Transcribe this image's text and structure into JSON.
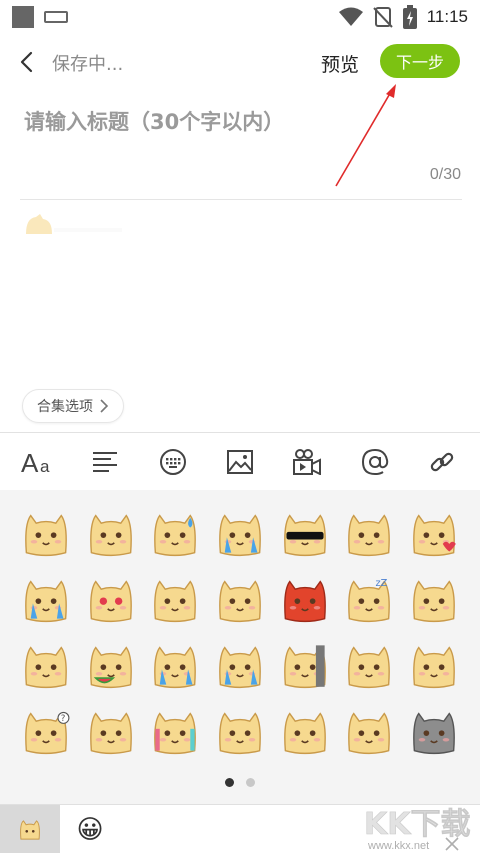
{
  "status_bar": {
    "time": "11:15"
  },
  "top_bar": {
    "saving_label": "保存中...",
    "preview_label": "预览",
    "next_label": "下一步"
  },
  "title_field": {
    "placeholder": "请输入标题（30个字以内）",
    "char_count": "0/30"
  },
  "body": {
    "collection_label": "合集选项"
  },
  "toolbar": {
    "items": [
      "font-icon",
      "align-icon",
      "keyboard-icon",
      "image-icon",
      "video-icon",
      "mention-icon",
      "link-icon"
    ],
    "font_label_big": "A",
    "font_label_small": "a"
  },
  "stickers": {
    "rows": 4,
    "columns": 7,
    "items": [
      "cat-blush",
      "cat-smile-cover",
      "cat-sweat",
      "cat-cry-blue",
      "cat-sunglasses",
      "cat-giggle",
      "cat-kiss-heart",
      "cat-cry-hands",
      "cat-heart-eyes",
      "cat-shy",
      "cat-think",
      "cat-angry-red",
      "cat-sleepy",
      "cat-sad",
      "cat-dizzy",
      "cat-watermelon",
      "cat-laugh-tears",
      "cat-sob",
      "cat-peek-wall",
      "cat-grin",
      "cat-shock",
      "cat-question",
      "cat-thumb",
      "cat-drink",
      "cat-tongue",
      "cat-neutral",
      "cat-laugh",
      "cat-grey-skull"
    ],
    "page_count": 2,
    "active_page": 1
  },
  "pack_bar": {
    "tabs": [
      "cat-pack",
      "emoji-pack"
    ],
    "selected": "cat-pack",
    "emoji_glyph": "😀"
  },
  "watermark": {
    "brand": "KK下载",
    "url": "www.kkx.net"
  },
  "colors": {
    "accent": "#7cc212",
    "annotation": "#e02b2b",
    "cat": "#f6d98f",
    "cat_line": "#c99a4a"
  }
}
